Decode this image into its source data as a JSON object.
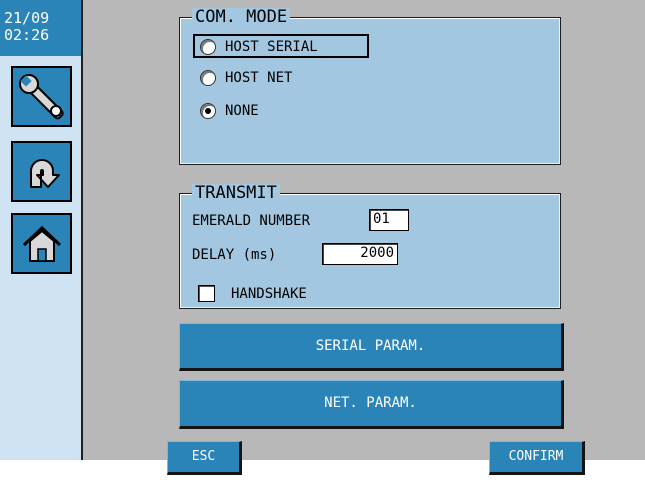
{
  "clock": {
    "date": "21/09",
    "time": "02:26"
  },
  "sidebar": {
    "items": [
      {
        "name": "tools",
        "icon": "wrench-icon"
      },
      {
        "name": "back",
        "icon": "return-arrow-icon"
      },
      {
        "name": "home",
        "icon": "home-icon"
      }
    ]
  },
  "com_mode": {
    "title": "COM. MODE",
    "options": [
      {
        "label": "HOST SERIAL",
        "selected": false,
        "focused": true
      },
      {
        "label": "HOST NET",
        "selected": false
      },
      {
        "label": "NONE",
        "selected": true
      }
    ]
  },
  "transmit": {
    "title": "TRANSMIT",
    "emerald_label": "EMERALD NUMBER",
    "emerald_value": "01",
    "delay_label": "DELAY (ms)",
    "delay_value": "2000",
    "handshake_label": "HANDSHAKE",
    "handshake_checked": false
  },
  "buttons": {
    "serial_param": "SERIAL PARAM.",
    "net_param": "NET. PARAM.",
    "esc": "ESC",
    "confirm": "CONFIRM"
  },
  "colors": {
    "accent": "#2a84b8",
    "panel": "#a3c7e0",
    "background": "#b8b8b8",
    "sidebar": "#cfe3f2"
  }
}
